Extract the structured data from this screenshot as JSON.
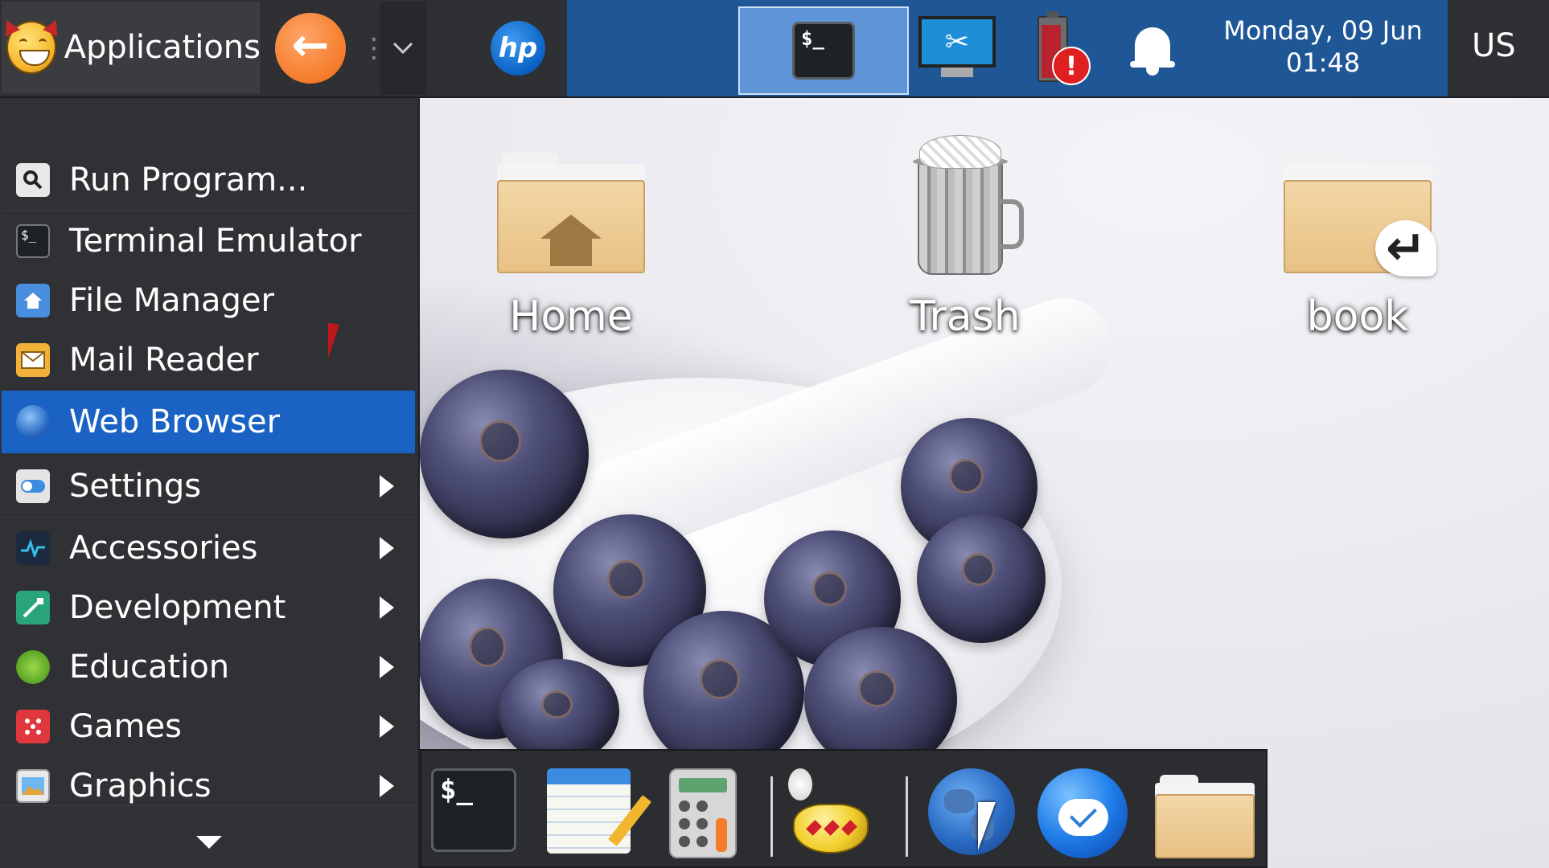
{
  "panel": {
    "applications_label": "Applications",
    "back_icon": "arrow-left-icon",
    "collapse_icon": "chevron-down-icon",
    "hp_logo_text": "hp",
    "active_task_icon": "terminal-icon",
    "terminal_glyph": "$_",
    "screenshot_glyph": "✂",
    "battery_warning_glyph": "!",
    "clock": {
      "date": "Monday, 09 Jun",
      "time": "01:48"
    },
    "keyboard_layout": "US"
  },
  "menu": {
    "items": [
      {
        "label": "Run Program...",
        "icon": "search-icon",
        "submenu": false
      },
      {
        "label": "Terminal Emulator",
        "icon": "terminal-icon",
        "submenu": false
      },
      {
        "label": "File Manager",
        "icon": "folder-home-icon",
        "submenu": false
      },
      {
        "label": "Mail Reader",
        "icon": "mail-icon",
        "submenu": false
      },
      {
        "label": "Web Browser",
        "icon": "globe-icon",
        "submenu": false,
        "highlighted": true
      },
      {
        "label": "Settings",
        "icon": "settings-toggle-icon",
        "submenu": true
      },
      {
        "label": "Accessories",
        "icon": "accessories-icon",
        "submenu": true
      },
      {
        "label": "Development",
        "icon": "development-icon",
        "submenu": true
      },
      {
        "label": "Education",
        "icon": "education-icon",
        "submenu": true
      },
      {
        "label": "Games",
        "icon": "dice-icon",
        "submenu": true
      },
      {
        "label": "Graphics",
        "icon": "graphics-icon",
        "submenu": true
      }
    ]
  },
  "desktop": {
    "icons": [
      {
        "label": "Home",
        "icon": "home-folder-icon"
      },
      {
        "label": "Trash",
        "icon": "trash-icon"
      },
      {
        "label": "book",
        "icon": "folder-link-icon"
      }
    ]
  },
  "dock": {
    "items": [
      {
        "name": "terminal",
        "icon": "terminal-icon",
        "glyph": "$_"
      },
      {
        "name": "text-editor",
        "icon": "notepad-icon"
      },
      {
        "name": "calculator",
        "icon": "calculator-icon"
      },
      {
        "name": "app-finder",
        "icon": "genie-lamp-icon"
      },
      {
        "name": "web-browser",
        "icon": "globe-icon"
      },
      {
        "name": "mail-client",
        "icon": "thunderbird-icon"
      },
      {
        "name": "file-manager",
        "icon": "folder-icon"
      }
    ]
  },
  "colors": {
    "panel_bg": "#2e3034",
    "taskbar_blue": "#1e5696",
    "active_task": "#5d95d6",
    "menu_bg": "#2f3134",
    "menu_highlight": "#1a62c4",
    "accent_orange": "#f57c2a"
  }
}
